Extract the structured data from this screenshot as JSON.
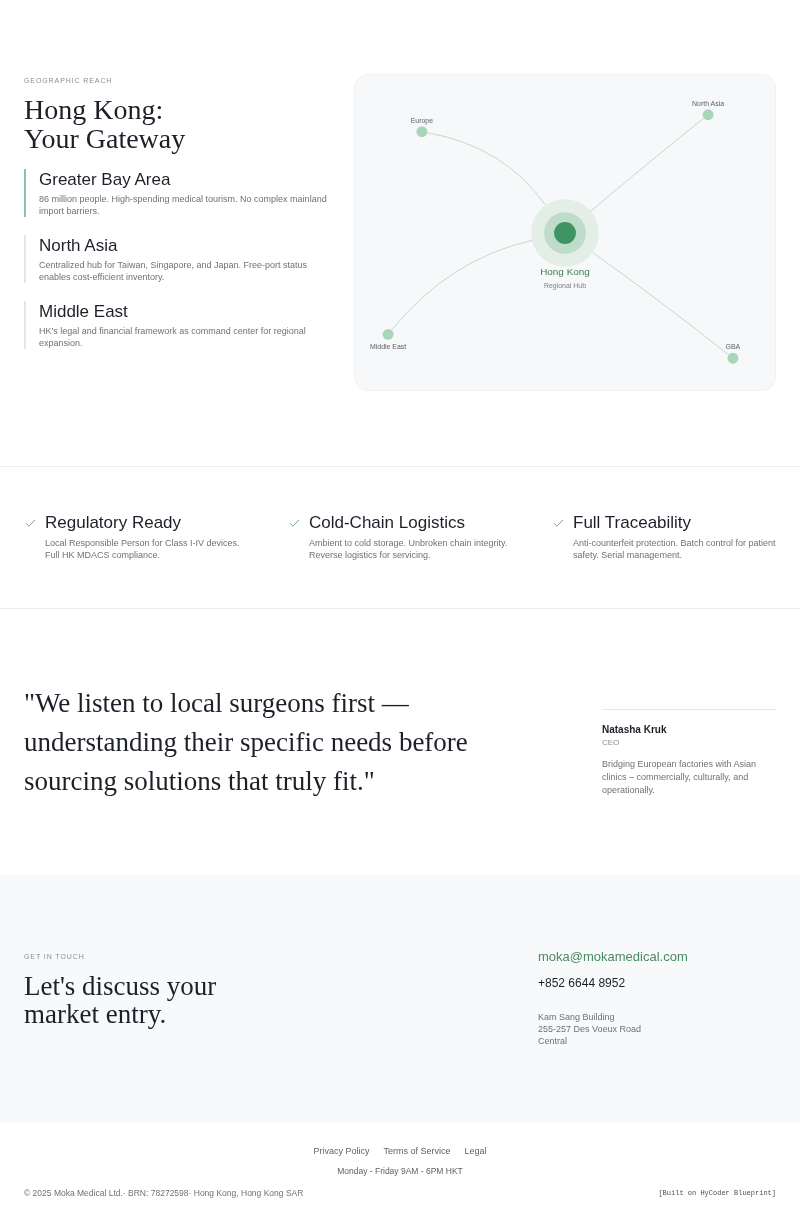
{
  "geographic_reach": {
    "eyebrow": "GEOGRAPHIC REACH",
    "title": "Hong Kong: Your Gateway",
    "regions": [
      {
        "title": "Greater Bay Area",
        "description": "86 million people. High-spending medical tourism. No complex mainland import barriers.",
        "selected": true
      },
      {
        "title": "North Asia",
        "description": "Centralized hub for Taiwan, Singapore, and Japan. Free-port status enables cost-efficient inventory.",
        "selected": false
      },
      {
        "title": "Middle East",
        "description": "HK's legal and financial framework as command center for regional expansion.",
        "selected": false
      }
    ]
  },
  "map": {
    "hub": {
      "label": "Hong Kong",
      "sublabel": "Regional Hub"
    },
    "destinations": [
      {
        "label": "Europe"
      },
      {
        "label": "North Asia"
      },
      {
        "label": "Middle East"
      },
      {
        "label": "GBA"
      }
    ]
  },
  "features": [
    {
      "title": "Regulatory Ready",
      "description": "Local Responsible Person for Class I-IV devices. Full HK MDACS compliance."
    },
    {
      "title": "Cold-Chain Logistics",
      "description": "Ambient to cold storage. Unbroken chain integrity. Reverse logistics for servicing."
    },
    {
      "title": "Full Traceability",
      "description": "Anti-counterfeit protection. Batch control for patient safety. Serial management."
    }
  ],
  "testimonial": {
    "quote": "\"We listen to local surgeons first — understanding their specific needs before sourcing solutions that truly fit.\"",
    "name": "Natasha Kruk",
    "role": "CEO",
    "bio": "Bridging European factories with Asian clinics – commercially, culturally, and operationally."
  },
  "contact": {
    "eyebrow": "GET IN TOUCH",
    "title": "Let's discuss your market entry.",
    "email": "moka@mokamedical.com",
    "phone": "+852 6644 8952",
    "address_lines": [
      "Kam Sang Building",
      "255-257 Des Voeux Road",
      "Central"
    ]
  },
  "footer": {
    "links": [
      "Privacy Policy",
      "Terms of Service",
      "Legal"
    ],
    "hours": "Monday - Friday 9AM - 6PM HKT",
    "copyright": "© 2025 Moka Medical Ltd.· BRN: 78272598· Hong Kong, Hong Kong SAR",
    "credit": "[Built on HyCoder Blueprint]"
  }
}
